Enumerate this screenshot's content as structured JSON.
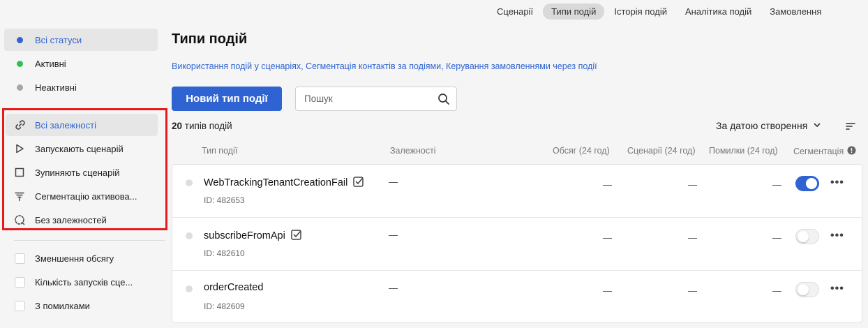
{
  "topnav": {
    "tabs": [
      {
        "label": "Сценарії",
        "active": false
      },
      {
        "label": "Типи подій",
        "active": true
      },
      {
        "label": "Історія подій",
        "active": false
      },
      {
        "label": "Аналітика подій",
        "active": false
      },
      {
        "label": "Замовлення",
        "active": false
      }
    ]
  },
  "sidebar": {
    "statuses": [
      {
        "label": "Всі статуси",
        "icon": "blue-dot-icon",
        "selected": true
      },
      {
        "label": "Активні",
        "icon": "green-dot-icon",
        "selected": false
      },
      {
        "label": "Неактивні",
        "icon": "gray-dot-icon",
        "selected": false
      }
    ],
    "dependencies": [
      {
        "label": "Всі залежності",
        "icon": "link-icon",
        "selected": true
      },
      {
        "label": "Запускають сценарій",
        "icon": "play-icon",
        "selected": false
      },
      {
        "label": "Зупиняють сценарій",
        "icon": "stop-icon",
        "selected": false
      },
      {
        "label": "Сегментацію активова...",
        "icon": "filter-icon",
        "selected": false
      },
      {
        "label": "Без залежностей",
        "icon": "broken-link-icon",
        "selected": false
      }
    ],
    "filters": [
      {
        "label": "Зменшення обсягу",
        "checked": false
      },
      {
        "label": "Кількість запусків сце...",
        "checked": false
      },
      {
        "label": "З помилками",
        "checked": false
      }
    ]
  },
  "main": {
    "title": "Типи подій",
    "links": [
      "Використання подій у сценаріях",
      "Сегментація контактів за подіями",
      "Керування замовленнями через події"
    ],
    "link_separator": ", ",
    "new_button": "Новий тип події",
    "search": {
      "placeholder": "Пошук",
      "value": ""
    },
    "count_number": "20",
    "count_text": " типів подій",
    "sort_label": "За датою створення",
    "columns": [
      "Тип події",
      "Залежності",
      "Обсяг (24 год)",
      "Сценарії (24 год)",
      "Помилки (24 год)",
      "Сегментація"
    ],
    "rows": [
      {
        "name": "WebTrackingTenantCreationFail",
        "id": "ID: 482653",
        "dependencies": "—",
        "volume": "—",
        "scenarios": "—",
        "errors": "—",
        "segmentation": true
      },
      {
        "name": "subscribeFromApi",
        "id": "ID: 482610",
        "dependencies": "—",
        "volume": "—",
        "scenarios": "—",
        "errors": "—",
        "segmentation": false
      },
      {
        "name": "orderCreated",
        "id": "ID: 482609",
        "dependencies": "—",
        "volume": "—",
        "scenarios": "—",
        "errors": "—",
        "segmentation": false
      }
    ]
  },
  "colors": {
    "accent": "#2e63d1",
    "active_status": "#2fbf54",
    "inactive_status": "#a6a6a6",
    "highlight": "#e51b1b"
  }
}
